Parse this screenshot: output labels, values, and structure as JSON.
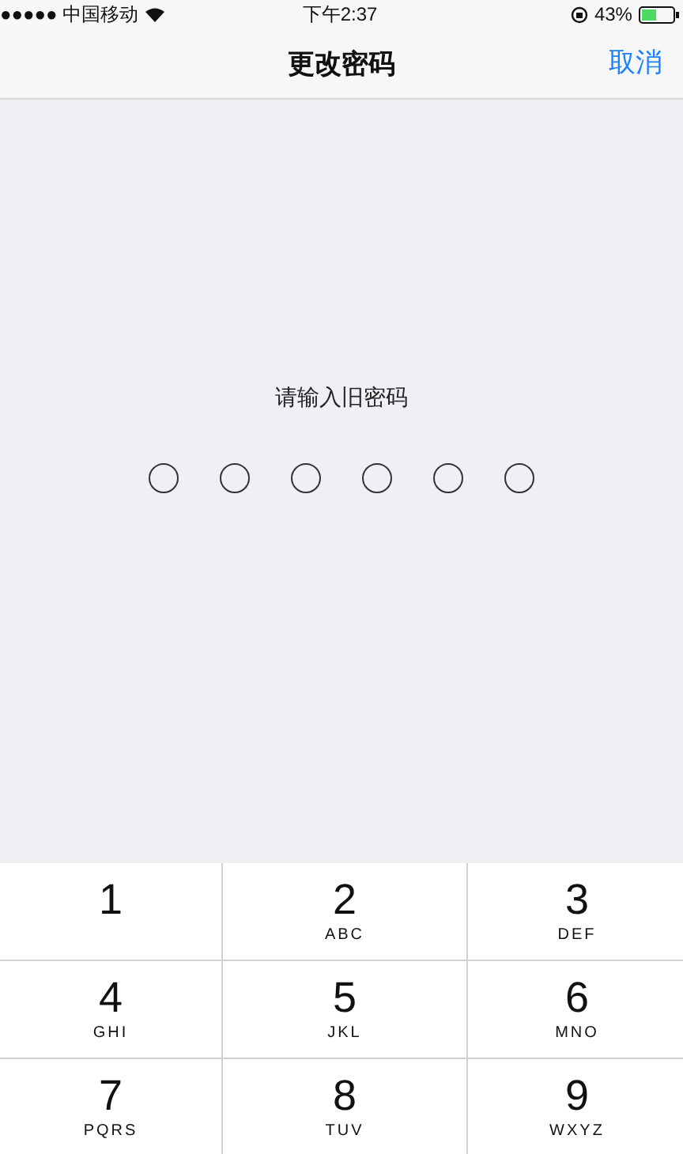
{
  "status_bar": {
    "carrier": "●●●●● 中国移动",
    "time": "下午2:37",
    "battery": "43%"
  },
  "nav": {
    "title": "更改密码",
    "cancel": "取消"
  },
  "prompt": "请输入旧密码",
  "dots": [
    {
      "filled": false
    },
    {
      "filled": false
    },
    {
      "filled": false
    },
    {
      "filled": false
    },
    {
      "filled": false
    },
    {
      "filled": false
    }
  ],
  "keys": [
    {
      "digit": "1"
    },
    {
      "digit": "2",
      "letters": "ABC"
    },
    {
      "digit": "3",
      "letters": "DEF"
    },
    {
      "digit": "4",
      "letters": "GHI"
    },
    {
      "digit": "5",
      "letters": "JKL"
    },
    {
      "digit": "6",
      "letters": "MNO"
    },
    {
      "digit": "7",
      "letters": "PQRS"
    },
    {
      "digit": "8",
      "letters": "TUV"
    },
    {
      "digit": "9",
      "letters": "WXYZ"
    }
  ]
}
